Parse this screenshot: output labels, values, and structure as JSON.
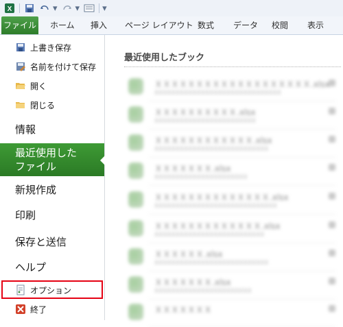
{
  "quick_access": {
    "icons": [
      "excel-logo-icon",
      "save-icon",
      "undo-icon",
      "redo-icon",
      "form-icon"
    ],
    "overflow_glyph": "▾"
  },
  "tabs": [
    "ファイル",
    "ホーム",
    "挿入",
    "ページ レイアウト",
    "数式",
    "データ",
    "校閲",
    "表示"
  ],
  "file_menu": {
    "save": "上書き保存",
    "save_as": "名前を付けて保存",
    "open": "開く",
    "close": "閉じる",
    "info": "情報",
    "recent_line1": "最近使用した",
    "recent_line2": "ファイル",
    "new": "新規作成",
    "print": "印刷",
    "save_send": "保存と送信",
    "help": "ヘルプ",
    "options": "オプション",
    "exit": "終了"
  },
  "recent": {
    "title": "最近使用したブック",
    "items": [
      {
        "name": "ＸＸＸＸＸＸＸＸＸＸＸＸＸＸＸＸＸＸＸ.xlsx",
        "path": "XXXXXXXXXXXXXXXXXXXXXXXXXXXXXX"
      },
      {
        "name": "ＸＸＸＸＸＸＸＸＸＸ.xlsx",
        "path": "XXXXXXXXXXXXXXXXXXXXXXXX"
      },
      {
        "name": "ＸＸＸＸＸＸＸＸＸＸＸＸ.xlsx",
        "path": "XXXXXXXXXXXXXXXXXXXXXXXXXXX"
      },
      {
        "name": "ＸＸＸＸＸＸＸ.xlsx",
        "path": "XXXXXXXXXXXXXXXXXXXXXX"
      },
      {
        "name": "ＸＸＸＸＸＸＸＸＸＸＸＸＸＸ.xlsx",
        "path": "XXXXXXXXXXXXXXXXXXXXXXXXXXXXX"
      },
      {
        "name": "ＸＸＸＸＸＸＸＸＸＸＸＸＸ.xlsx",
        "path": "XXXXXXXXXXXXXXXXXXXXXXXXXX"
      },
      {
        "name": "ＸＸＸＸＸＸ.xlsx",
        "path": "XXXXXXXXXXXXXXXXXXXXXXXXXXX"
      },
      {
        "name": "ＸＸＸＸＸＸＸ.xlsx",
        "path": "XXXXXXXXXXXXXXXXXXXXXXX"
      },
      {
        "name": "ＸＸＸＸＸＸＸ",
        "path": ""
      }
    ]
  },
  "colors": {
    "file_tab": "#2e7d2a",
    "active_item": "#3e9a35",
    "highlight_box": "#e50012"
  }
}
